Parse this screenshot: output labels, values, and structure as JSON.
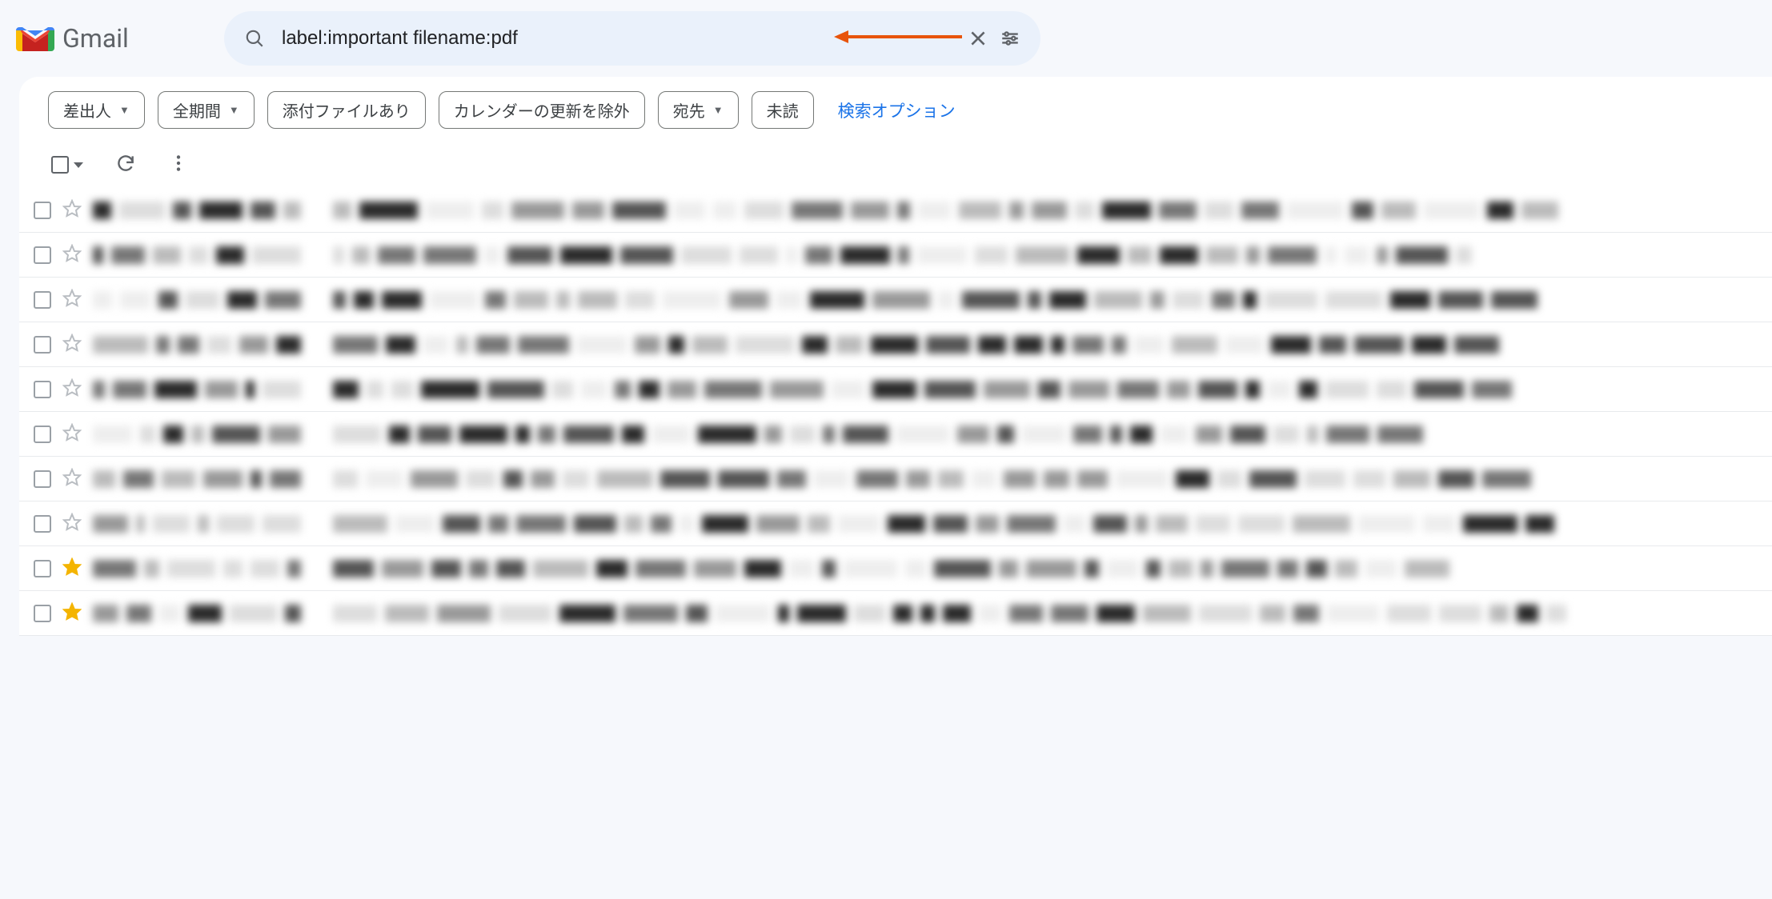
{
  "app": {
    "name": "Gmail"
  },
  "search": {
    "query": "label:important filename:pdf",
    "placeholder": ""
  },
  "filters": {
    "from": "差出人",
    "time": "全期間",
    "has_attachment": "添付ファイルあり",
    "exclude_calendar": "カレンダーの更新を除外",
    "to": "宛先",
    "unread": "未読",
    "search_options": "検索オプション"
  },
  "emails": [
    {
      "starred": false
    },
    {
      "starred": false
    },
    {
      "starred": false
    },
    {
      "starred": false
    },
    {
      "starred": false
    },
    {
      "starred": false
    },
    {
      "starred": false
    },
    {
      "starred": false
    },
    {
      "starred": true
    },
    {
      "starred": true
    }
  ]
}
